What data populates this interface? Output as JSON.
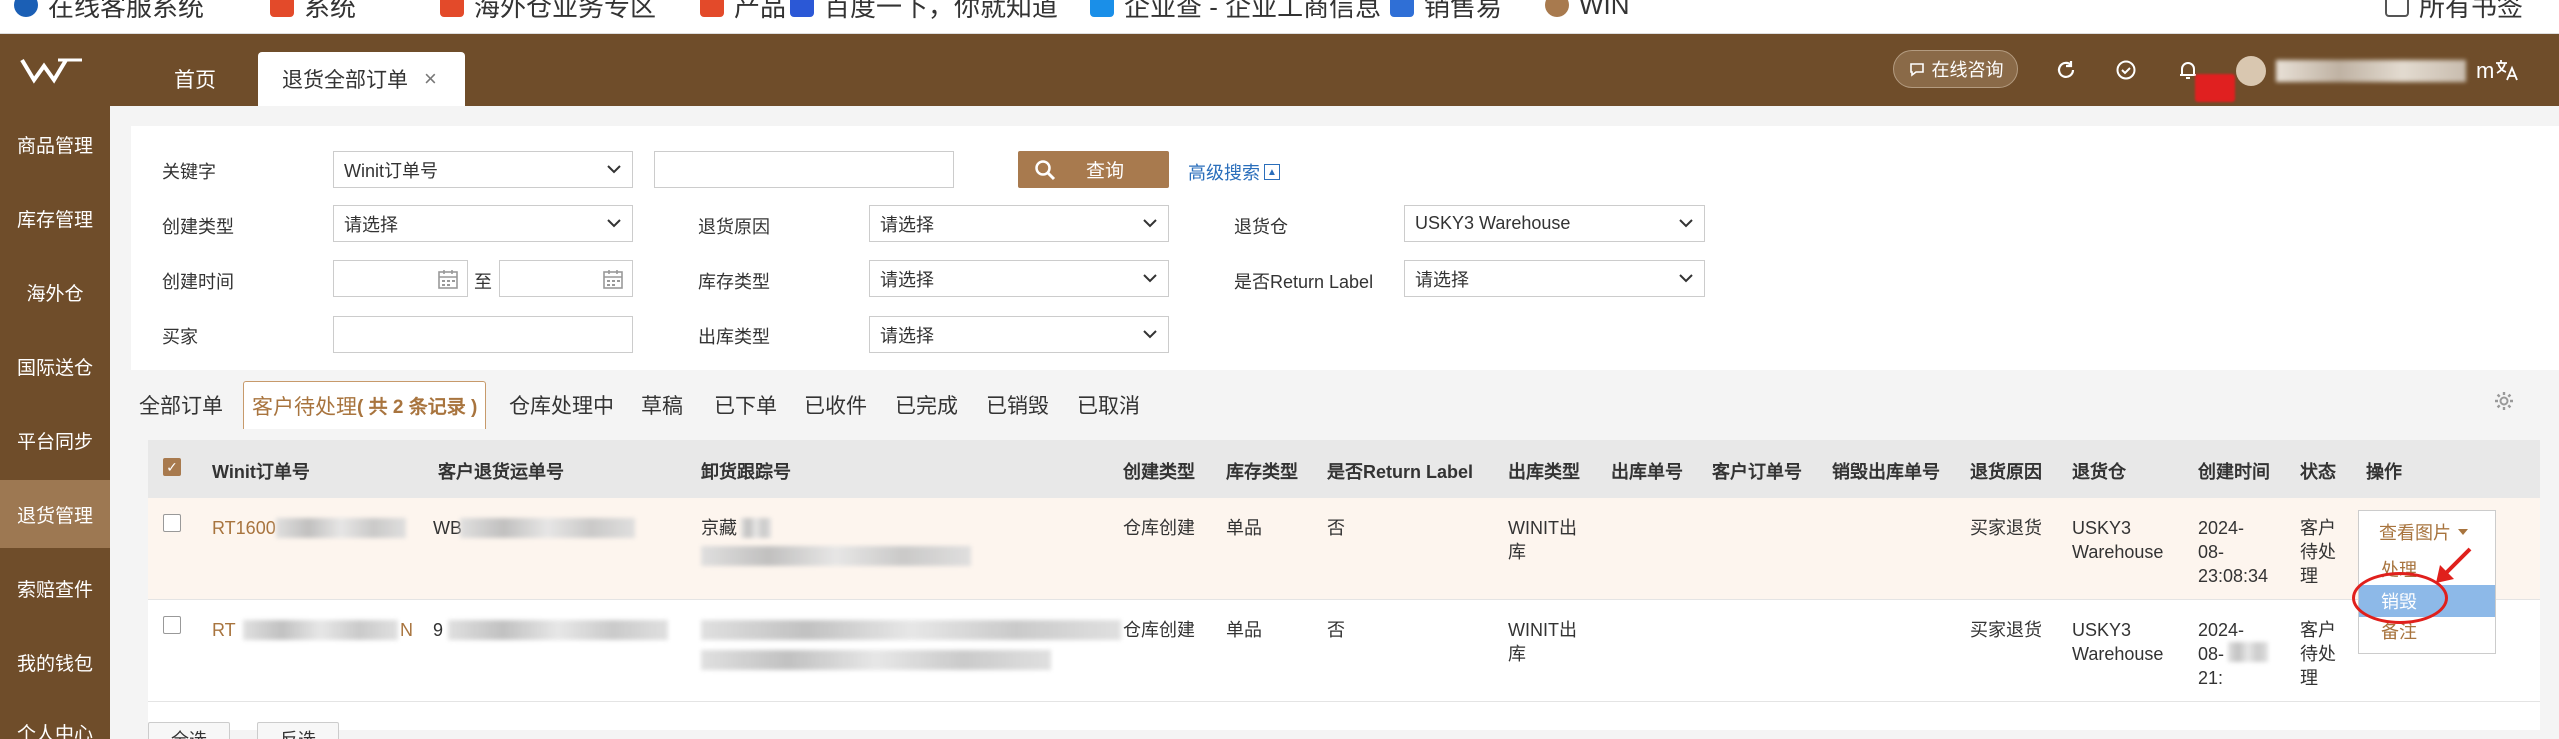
{
  "bookmarks": [
    {
      "label": "在线客服系统",
      "color": "#1b5fb5"
    },
    {
      "label": "系统",
      "color": "#e34a2a"
    },
    {
      "label": "海外仓业务专区",
      "color": "#e34a2a"
    },
    {
      "label": "产品",
      "color": "#e34a2a"
    },
    {
      "label": "百度一下，你就知道",
      "color": "#2b58d6"
    },
    {
      "label": "企业查 - 企业工商信息",
      "color": "#1a8fe8"
    },
    {
      "label": "销售易",
      "color": "#2f6fd6"
    },
    {
      "label": "WIN",
      "color": "#a87a4e"
    },
    {
      "label": "所有书签",
      "color": "#555555"
    }
  ],
  "header": {
    "home_tab": "首页",
    "active_tab": "退货全部订单",
    "close_glyph": "×",
    "consult_label": "在线咨询",
    "user_suffix": "m"
  },
  "sidebar": {
    "items": [
      "商品管理",
      "库存管理",
      "海外仓",
      "国际送仓",
      "平台同步",
      "退货管理",
      "索赔查件",
      "我的钱包",
      "个人中心"
    ],
    "active_index": 5
  },
  "filter": {
    "keyword_label": "关键字",
    "keyword_select": "Winit订单号",
    "search_button": "查询",
    "advanced_search": "高级搜索",
    "create_type_label": "创建类型",
    "create_type_value": "请选择",
    "return_reason_label": "退货原因",
    "return_reason_value": "请选择",
    "return_wh_label": "退货仓",
    "return_wh_value": "USKY3 Warehouse",
    "create_time_label": "创建时间",
    "to_label": "至",
    "stock_type_label": "库存类型",
    "stock_type_value": "请选择",
    "return_label_label": "是否Return Label",
    "return_label_value": "请选择",
    "buyer_label": "买家",
    "outbound_type_label": "出库类型",
    "outbound_type_value": "请选择"
  },
  "status_tabs": [
    {
      "label": "全部订单"
    },
    {
      "label": "客户待处理",
      "count_text": "( 共 2 条记录 )"
    },
    {
      "label": "仓库处理中"
    },
    {
      "label": "草稿"
    },
    {
      "label": "已下单"
    },
    {
      "label": "已收件"
    },
    {
      "label": "已完成"
    },
    {
      "label": "已销毁"
    },
    {
      "label": "已取消"
    }
  ],
  "table": {
    "headers": [
      "Winit订单号",
      "客户退货运单号",
      "卸货跟踪号",
      "创建类型",
      "库存类型",
      "是否Return Label",
      "出库类型",
      "出库单号",
      "客户订单号",
      "销毁出库单号",
      "退货原因",
      "退货仓",
      "创建时间",
      "状态",
      "操作"
    ],
    "rows": [
      {
        "order": "RT1600",
        "customer_tracking": "WB",
        "unload_tracking": "京藏",
        "create_type": "仓库创建",
        "stock_type": "单品",
        "return_label": "否",
        "outbound": [
          "WINIT出",
          "库"
        ],
        "reason": "买家退货",
        "warehouse": [
          "USKY3",
          "Warehouse"
        ],
        "created": [
          "2024-",
          "08-",
          "23:08:34"
        ],
        "status": [
          "客户",
          "待处",
          "理"
        ]
      },
      {
        "order": "RT",
        "order_suffix": "N",
        "customer_tracking": "9",
        "unload_tracking": "",
        "create_type": "仓库创建",
        "stock_type": "单品",
        "return_label": "否",
        "outbound": [
          "WINIT出",
          "库"
        ],
        "reason": "买家退货",
        "warehouse": [
          "USKY3",
          "Warehouse"
        ],
        "created": [
          "2024-",
          "08-",
          "21:"
        ],
        "status": [
          "客户",
          "待处",
          "理"
        ]
      }
    ]
  },
  "action_menu": {
    "view_label": "查看图片",
    "items": [
      "处理",
      "销毁",
      "备注"
    ],
    "highlighted_index": 1
  },
  "bottom": {
    "select_all": "全选",
    "invert": "反选"
  }
}
